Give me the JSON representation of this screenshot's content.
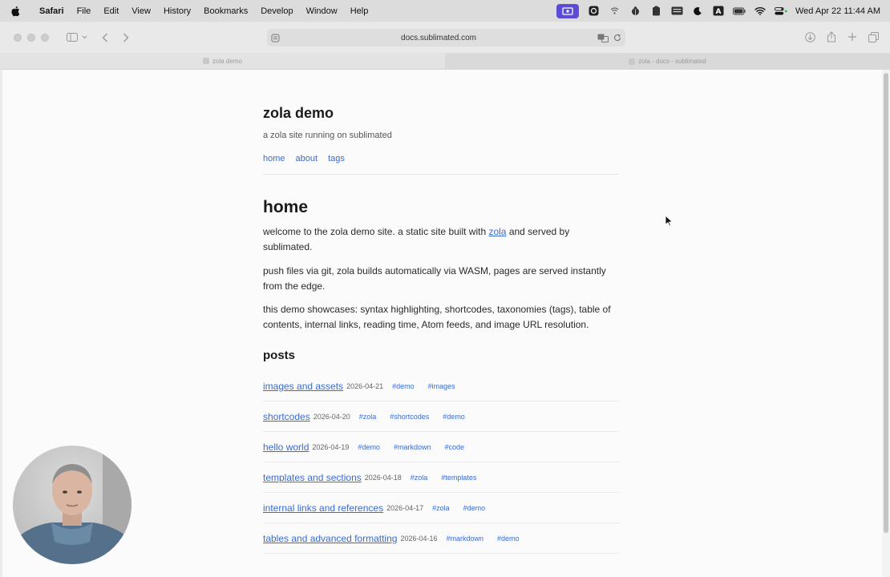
{
  "menubar": {
    "app_name": "Safari",
    "items": [
      "File",
      "Edit",
      "View",
      "History",
      "Bookmarks",
      "Develop",
      "Window",
      "Help"
    ],
    "clock": "Wed Apr 22  11:44 AM",
    "accent": "#5b4bd6"
  },
  "browser": {
    "url": "docs.sublimated.com",
    "tabs": [
      {
        "label": "zola demo",
        "active": false
      },
      {
        "label": "zola - docs - sublimated",
        "active": true
      }
    ]
  },
  "site": {
    "title": "zola demo",
    "subtitle": "a zola site running on sublimated",
    "nav": [
      "home",
      "about",
      "tags"
    ],
    "link_color": "#3a6bd0"
  },
  "page": {
    "title": "home",
    "p1_before": "welcome to the zola demo site. a static site built with ",
    "p1_link": "zola",
    "p1_after": " and served by sublimated.",
    "p2": "push files via git, zola builds automatically via WASM, pages are served instantly from the edge.",
    "p3": "this demo showcases: syntax highlighting, shortcodes, taxonomies (tags), table of contents, internal links, reading time, Atom feeds, and image URL resolution.",
    "posts_heading": "posts"
  },
  "posts": [
    {
      "title": "images and assets",
      "date": "2026-04-21",
      "tags": [
        "#demo",
        "#images"
      ]
    },
    {
      "title": "shortcodes",
      "date": "2026-04-20",
      "tags": [
        "#zola",
        "#shortcodes",
        "#demo"
      ]
    },
    {
      "title": "hello world",
      "date": "2026-04-19",
      "tags": [
        "#demo",
        "#markdown",
        "#code"
      ]
    },
    {
      "title": "templates and sections",
      "date": "2026-04-18",
      "tags": [
        "#zola",
        "#templates"
      ]
    },
    {
      "title": "internal links and references",
      "date": "2026-04-17",
      "tags": [
        "#zola",
        "#demo"
      ]
    },
    {
      "title": "tables and advanced formatting",
      "date": "2026-04-16",
      "tags": [
        "#markdown",
        "#demo"
      ]
    }
  ]
}
